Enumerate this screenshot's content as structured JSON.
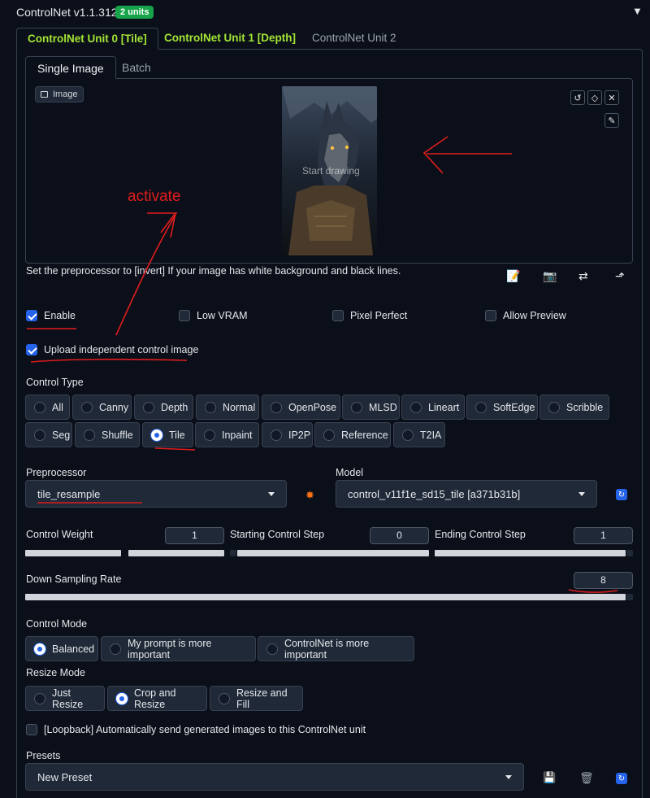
{
  "header": {
    "title": "ControlNet v1.1.312",
    "units_badge": "2 units",
    "collapse_icon": "▼"
  },
  "unit_tabs": [
    {
      "label": "ControlNet Unit 0 [Tile]"
    },
    {
      "label": "ControlNet Unit 1 [Depth]"
    },
    {
      "label": "ControlNet Unit 2"
    }
  ],
  "image_tabs": [
    {
      "label": "Single Image"
    },
    {
      "label": "Batch"
    }
  ],
  "image_panel": {
    "label": "Image",
    "placeholder": "Start drawing",
    "tool_icons": [
      "undo-icon",
      "eraser-icon",
      "close-icon",
      "pen-icon"
    ]
  },
  "hint": "Set the preprocessor to [invert] If your image has white background and black lines.",
  "checkboxes": {
    "enable": {
      "label": "Enable",
      "checked": true
    },
    "low_vram": {
      "label": "Low VRAM",
      "checked": false
    },
    "pixel_perfect": {
      "label": "Pixel Perfect",
      "checked": false
    },
    "allow_preview": {
      "label": "Allow Preview",
      "checked": false
    },
    "upload_independent": {
      "label": "Upload independent control image",
      "checked": true
    },
    "loopback": {
      "label": "[Loopback] Automatically send generated images to this ControlNet unit",
      "checked": false
    }
  },
  "control_type": {
    "label": "Control Type",
    "row1": [
      "All",
      "Canny",
      "Depth",
      "Normal",
      "OpenPose",
      "MLSD",
      "Lineart",
      "SoftEdge",
      "Scribble"
    ],
    "row2": [
      "Seg",
      "Shuffle",
      "Tile",
      "Inpaint",
      "IP2P",
      "Reference",
      "T2IA"
    ],
    "selected": "Tile"
  },
  "preprocessor": {
    "label": "Preprocessor",
    "value": "tile_resample"
  },
  "model": {
    "label": "Model",
    "value": "control_v11f1e_sd15_tile [a371b31b]"
  },
  "sliders": {
    "control_weight": {
      "label": "Control Weight",
      "value": "1"
    },
    "starting_step": {
      "label": "Starting Control Step",
      "value": "0"
    },
    "ending_step": {
      "label": "Ending Control Step",
      "value": "1"
    },
    "down_sampling": {
      "label": "Down Sampling Rate",
      "value": "8"
    }
  },
  "control_mode": {
    "label": "Control Mode",
    "options": [
      "Balanced",
      "My prompt is more important",
      "ControlNet is more important"
    ],
    "selected": "Balanced"
  },
  "resize_mode": {
    "label": "Resize Mode",
    "options": [
      "Just Resize",
      "Crop and Resize",
      "Resize and Fill"
    ],
    "selected": "Crop and Resize"
  },
  "presets": {
    "label": "Presets",
    "value": "New Preset"
  },
  "annotation": {
    "text": "activate"
  }
}
